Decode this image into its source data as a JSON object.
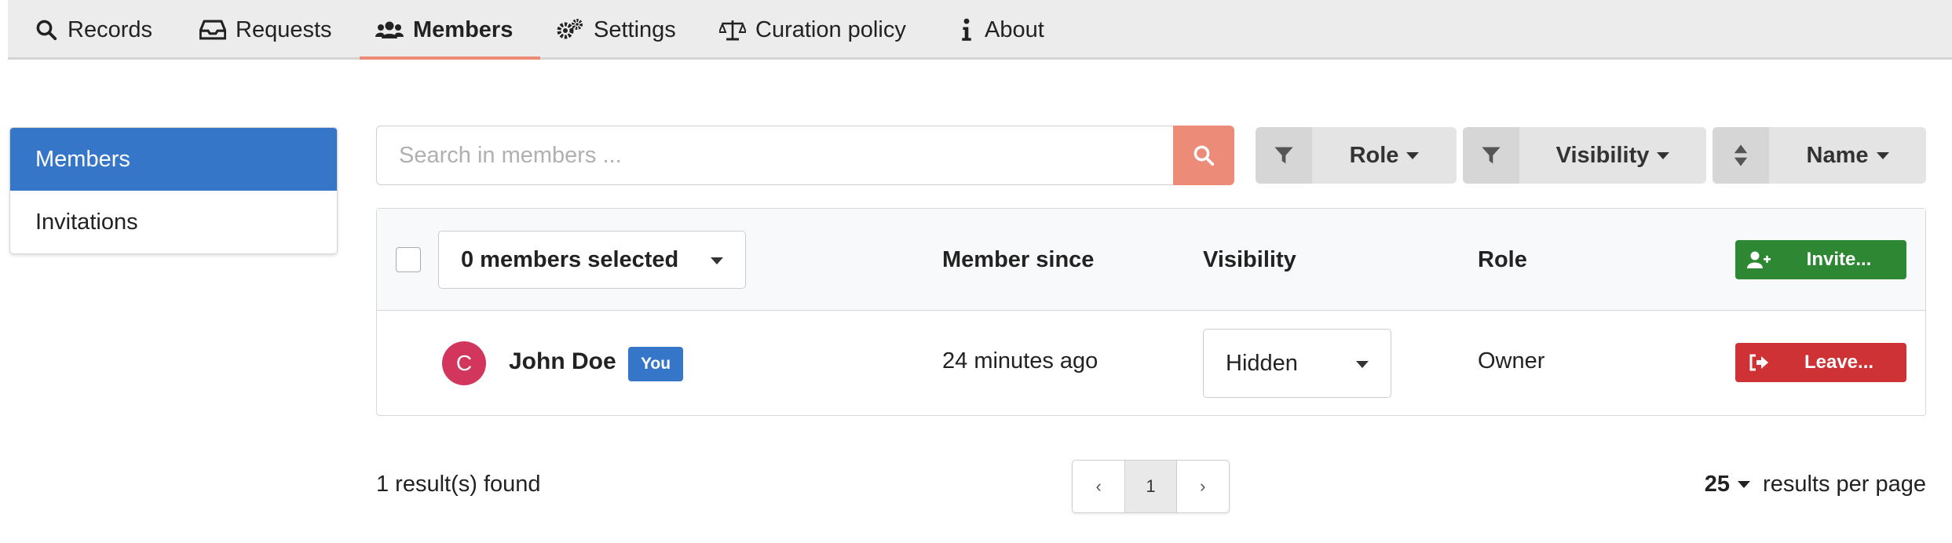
{
  "nav": {
    "tabs": [
      {
        "label": "Records",
        "icon": "search-icon"
      },
      {
        "label": "Requests",
        "icon": "inbox-icon"
      },
      {
        "label": "Members",
        "icon": "users-icon",
        "active": true
      },
      {
        "label": "Settings",
        "icon": "cogs-icon"
      },
      {
        "label": "Curation policy",
        "icon": "balance-scale-icon"
      },
      {
        "label": "About",
        "icon": "info-icon"
      }
    ],
    "active_underline_color": "#ec8b78"
  },
  "sidebar": {
    "items": [
      {
        "label": "Members",
        "active": true
      },
      {
        "label": "Invitations"
      }
    ],
    "active_color": "#3676c9"
  },
  "search": {
    "placeholder": "Search in members ...",
    "button_color": "#ec8b78"
  },
  "filters": {
    "role": "Role",
    "visibility": "Visibility",
    "sort": "Name"
  },
  "table": {
    "selection_label": "0 members selected",
    "headers": {
      "member_since": "Member since",
      "visibility": "Visibility",
      "role": "Role"
    },
    "invite_button": "Invite...",
    "rows": [
      {
        "avatar_letter": "C",
        "name": "John Doe",
        "badge": "You",
        "member_since": "24 minutes ago",
        "visibility": "Hidden",
        "role": "Owner",
        "action": "Leave..."
      }
    ]
  },
  "footer": {
    "results_text": "1 result(s) found",
    "pagination": {
      "prev": "‹",
      "current": "1",
      "next": "›"
    },
    "per_page_value": "25",
    "per_page_label": "results per page"
  },
  "colors": {
    "invite_green": "#2e8733",
    "leave_red": "#cf3235",
    "avatar": "#d3365c",
    "badge_blue": "#3676c9"
  }
}
